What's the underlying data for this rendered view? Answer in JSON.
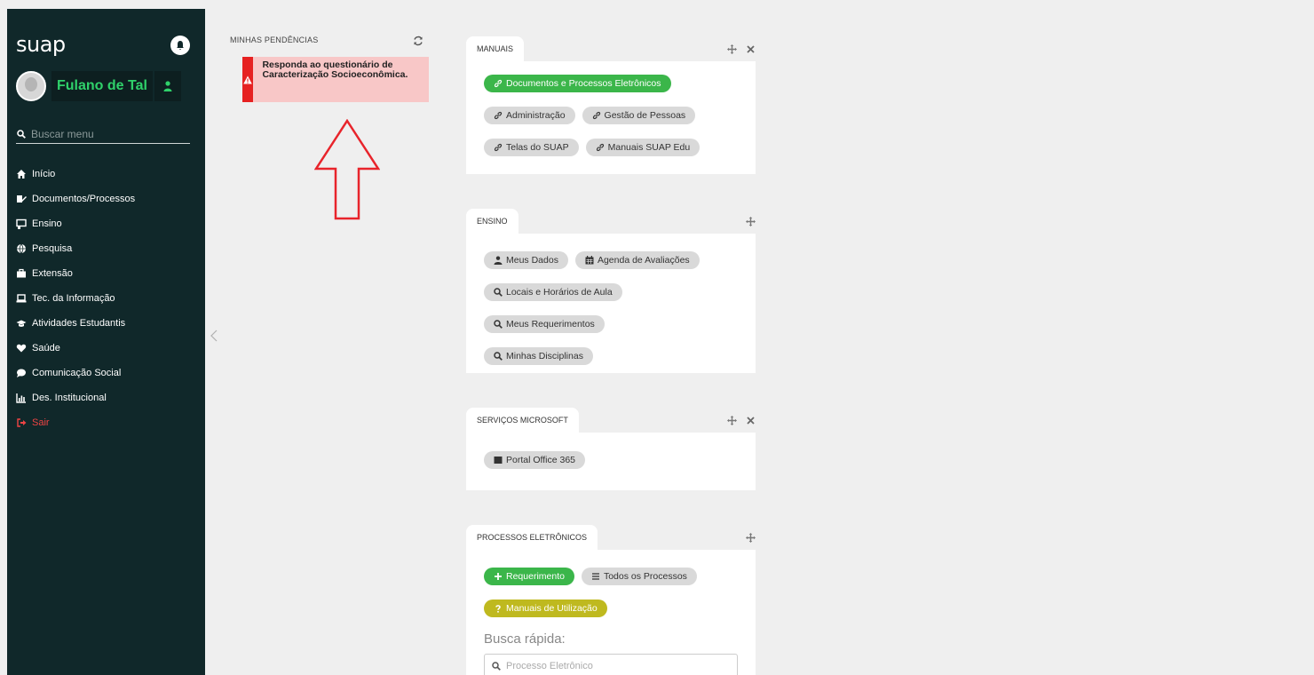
{
  "sidebar": {
    "brand": "suap",
    "user_name": "Fulano de Tal",
    "search_placeholder": "Buscar menu",
    "menu": [
      {
        "label": "Início",
        "icon": "home-icon"
      },
      {
        "label": "Documentos/Processos",
        "icon": "document-edit-icon"
      },
      {
        "label": "Ensino",
        "icon": "chalkboard-icon"
      },
      {
        "label": "Pesquisa",
        "icon": "globe-icon"
      },
      {
        "label": "Extensão",
        "icon": "briefcase-icon"
      },
      {
        "label": "Tec. da Informação",
        "icon": "laptop-icon"
      },
      {
        "label": "Atividades Estudantis",
        "icon": "graduation-cap-icon"
      },
      {
        "label": "Saúde",
        "icon": "heart-icon"
      },
      {
        "label": "Comunicação Social",
        "icon": "comment-icon"
      },
      {
        "label": "Des. Institucional",
        "icon": "chart-icon"
      },
      {
        "label": "Sair",
        "icon": "sign-out-icon"
      }
    ]
  },
  "pendencias": {
    "title": "MINHAS PENDÊNCIAS",
    "alert": "Responda ao questionário de Caracterização Socioeconômica."
  },
  "manuais": {
    "title": "MANUAIS",
    "links": [
      "Documentos e Processos Eletrônicos",
      "Administração",
      "Gestão de Pessoas",
      "Telas do SUAP",
      "Manuais SUAP Edu"
    ]
  },
  "ensino": {
    "title": "ENSINO",
    "links": [
      "Meus Dados",
      "Agenda de Avaliações",
      "Locais e Horários de Aula",
      "Meus Requerimentos",
      "Minhas Disciplinas"
    ]
  },
  "microsoft": {
    "title": "SERVIÇOS MICROSOFT",
    "links": [
      "Portal Office 365"
    ]
  },
  "processos": {
    "title": "PROCESSOS ELETRÔNICOS",
    "links": [
      "Requerimento",
      "Todos os Processos",
      "Manuais de Utilização"
    ],
    "busca_label": "Busca rápida:",
    "busca_placeholder": "Processo Eletrônico"
  },
  "colors": {
    "sidebar_bg": "#10282a",
    "accent_green": "#3bb64a",
    "user_name_green": "#2fd16a",
    "alert_red": "#e62121",
    "alert_bg": "#f8c7c7",
    "olive": "#bfb91f",
    "exit_red": "#ee4444"
  }
}
